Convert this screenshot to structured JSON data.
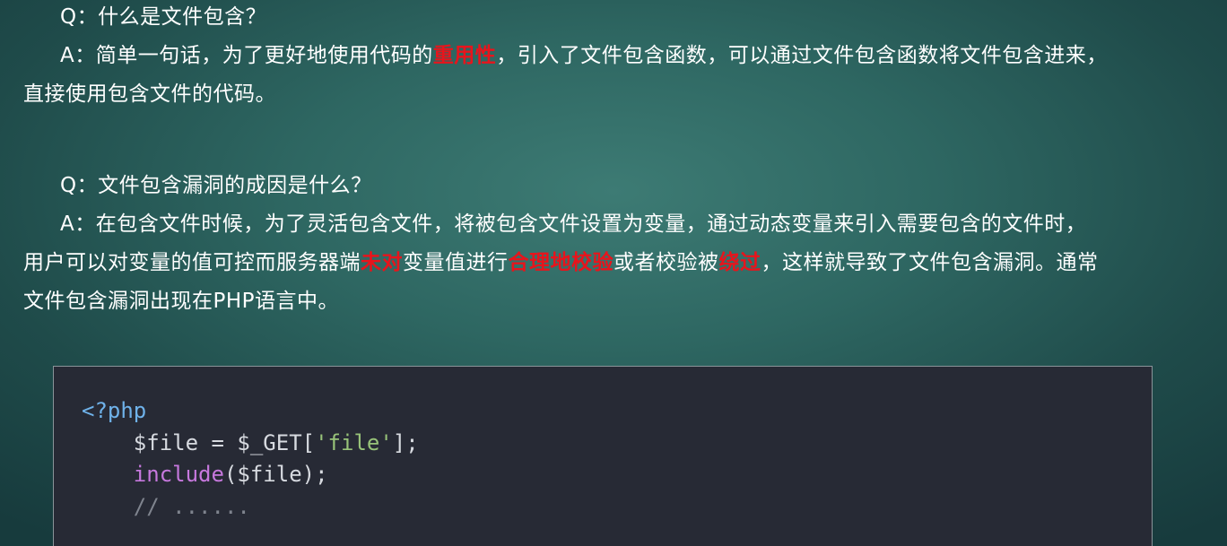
{
  "qa1": {
    "q": "Q：什么是文件包含？",
    "a_prefix": "A：简单一句话，为了更好地使用代码的",
    "a_hl1": "重用性",
    "a_mid": "，引入了文件包含函数，可以通过文件包含函数将文件包含进来，",
    "a_line2": "直接使用包含文件的代码。"
  },
  "qa2": {
    "q": "Q：文件包含漏洞的成因是什么？",
    "a_line1": "A：在包含文件时候，为了灵活包含文件，将被包含文件设置为变量，通过动态变量来引入需要包含的文件时，",
    "a_line2_pre": "用户可以对变量的值可控而服务器端",
    "a_hl1": "未对",
    "a_line2_mid": "变量值进行",
    "a_hl2": "合理地校验",
    "a_line2_mid2": "或者校验被",
    "a_hl3": "绕过",
    "a_line2_post": "，这样就导致了文件包含漏洞。通常",
    "a_line3": "文件包含漏洞出现在PHP语言中。"
  },
  "code": {
    "line1_tag": "<?php",
    "line2_var": "$file = $_GET[",
    "line2_str": "'file'",
    "line2_end": "];",
    "line3_kw": "include",
    "line3_rest": "($file);",
    "line4_comment": "// ......"
  },
  "colors": {
    "highlight": "#e8141c",
    "code_bg": "#272a35",
    "php_tag": "#6fb2ea",
    "keyword": "#c678dd",
    "string": "#98c379",
    "comment": "#7f848e"
  }
}
